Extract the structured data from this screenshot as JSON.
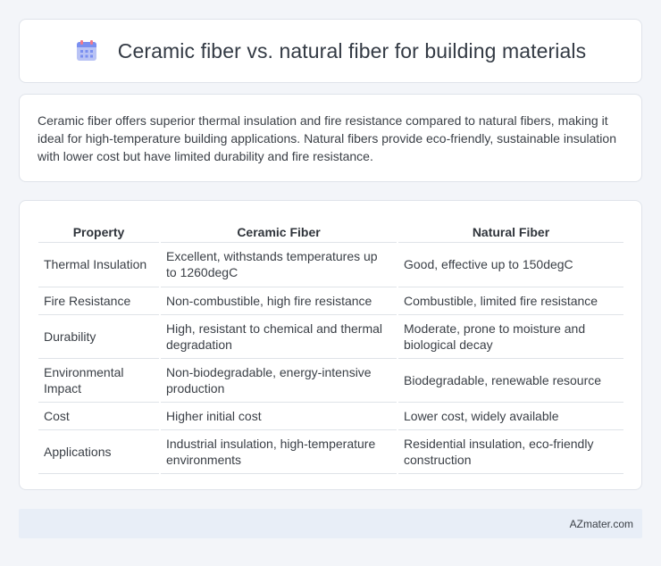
{
  "header": {
    "title": "Ceramic fiber vs. natural fiber for building materials",
    "icon": "calendar-icon",
    "icon_colors": [
      "#7a8ff0",
      "#f07a8a",
      "#b9c3f5"
    ]
  },
  "summary": {
    "text": "Ceramic fiber offers superior thermal insulation and fire resistance compared to natural fibers, making it ideal for high-temperature building applications. Natural fibers provide eco-friendly, sustainable insulation with lower cost but have limited durability and fire resistance."
  },
  "table": {
    "headers": [
      "Property",
      "Ceramic Fiber",
      "Natural Fiber"
    ],
    "rows": [
      [
        "Thermal Insulation",
        "Excellent, withstands temperatures up to 1260degC",
        "Good, effective up to 150degC"
      ],
      [
        "Fire Resistance",
        "Non-combustible, high fire resistance",
        "Combustible, limited fire resistance"
      ],
      [
        "Durability",
        "High, resistant to chemical and thermal degradation",
        "Moderate, prone to moisture and biological decay"
      ],
      [
        "Environmental Impact",
        "Non-biodegradable, energy-intensive production",
        "Biodegradable, renewable resource"
      ],
      [
        "Cost",
        "Higher initial cost",
        "Lower cost, widely available"
      ],
      [
        "Applications",
        "Industrial insulation, high-temperature environments",
        "Residential insulation, eco-friendly construction"
      ]
    ]
  },
  "footer": {
    "text": "AZmater.com"
  }
}
